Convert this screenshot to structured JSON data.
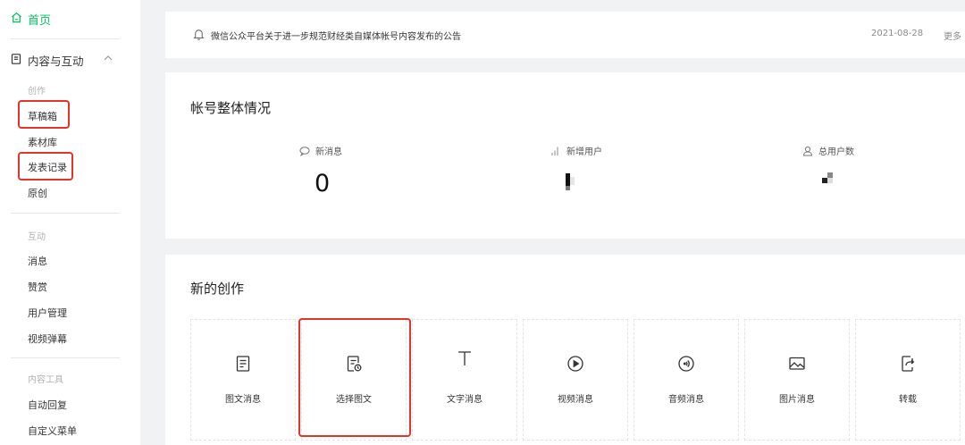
{
  "sidebar": {
    "home": "首页",
    "section": "内容与互动",
    "groups": [
      {
        "label": "创作",
        "items": [
          "草稿箱",
          "素材库",
          "发表记录",
          "原创"
        ]
      },
      {
        "label": "互动",
        "items": [
          "消息",
          "赞赏",
          "用户管理",
          "视频弹幕"
        ]
      },
      {
        "label": "内容工具",
        "items": [
          "自动回复",
          "自定义菜单"
        ]
      }
    ]
  },
  "notice": {
    "text": "微信公众平台关于进一步规范财经类自媒体帐号内容发布的公告",
    "date": "2021-08-28",
    "more": "更多"
  },
  "overview": {
    "title": "帐号整体情况",
    "stats": [
      {
        "label": "新消息",
        "value": "0",
        "icon": "chat-bubble-icon"
      },
      {
        "label": "新增用户",
        "value": "",
        "icon": "bar-chart-icon"
      },
      {
        "label": "总用户数",
        "value": "",
        "icon": "user-icon"
      }
    ]
  },
  "create": {
    "title": "新的创作",
    "cards": [
      {
        "label": "图文消息",
        "icon": "document-icon"
      },
      {
        "label": "选择图文",
        "icon": "document-clock-icon"
      },
      {
        "label": "文字消息",
        "icon": "text-icon"
      },
      {
        "label": "视频消息",
        "icon": "play-icon"
      },
      {
        "label": "音频消息",
        "icon": "audio-icon"
      },
      {
        "label": "图片消息",
        "icon": "image-icon"
      },
      {
        "label": "转载",
        "icon": "repost-icon"
      }
    ]
  },
  "colors": {
    "accent": "#07c160",
    "highlight": "#e5332a"
  }
}
